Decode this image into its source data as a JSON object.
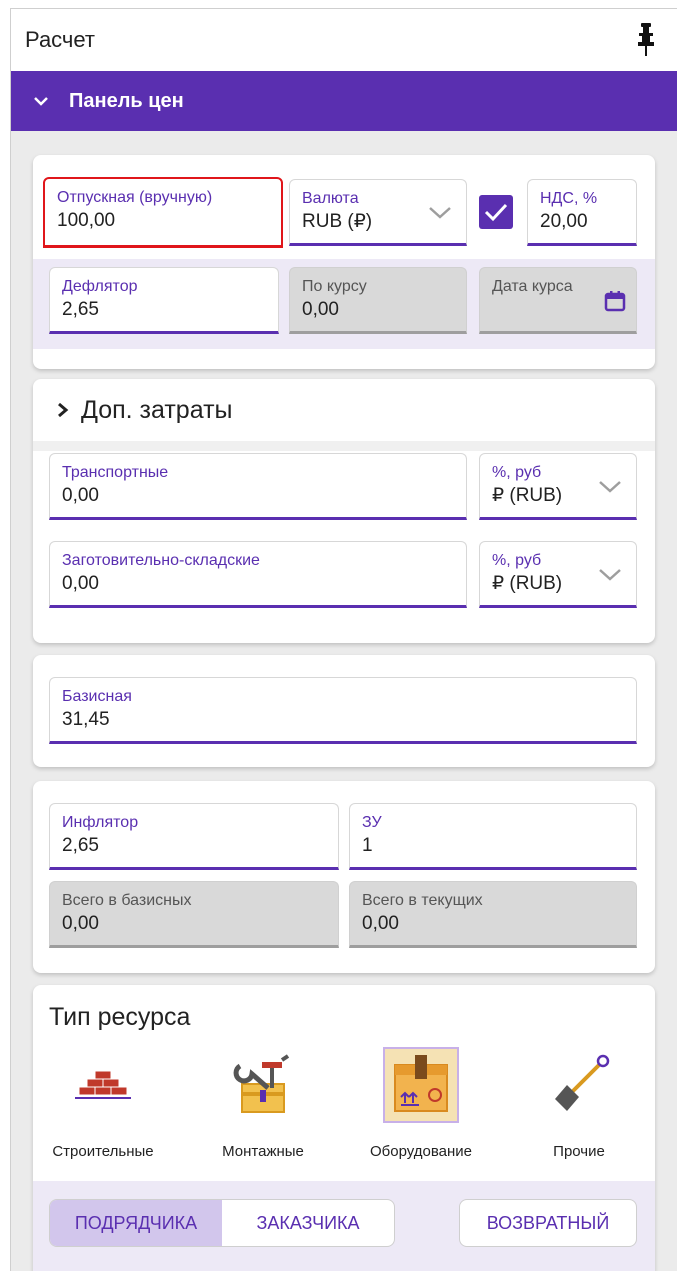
{
  "window": {
    "title": "Расчет",
    "pin_icon": "pin-icon"
  },
  "panel": {
    "title": "Панель цен",
    "chevron_icon": "chevron-down-icon"
  },
  "prices": {
    "release": {
      "label": "Отпускная (вручную)",
      "value": "100,00"
    },
    "currency": {
      "label": "Валюта",
      "value": "RUB (₽)"
    },
    "vat_checkbox": {
      "checked": true
    },
    "vat": {
      "label": "НДС, %",
      "value": "20,00"
    },
    "deflator": {
      "label": "Дефлятор",
      "value": "2,65"
    },
    "by_rate": {
      "label": "По курсу",
      "value": "0,00"
    },
    "rate_date": {
      "label": "Дата курса",
      "value": "",
      "icon": "calendar-icon"
    }
  },
  "extra_costs": {
    "title": "Доп. затраты",
    "transport": {
      "label": "Транспортные",
      "value": "0,00",
      "unit_label": "%, руб",
      "unit_value": "₽ (RUB)"
    },
    "warehouse": {
      "label": "Заготовительно-складские",
      "value": "0,00",
      "unit_label": "%, руб",
      "unit_value": "₽ (RUB)"
    }
  },
  "base": {
    "label": "Базисная",
    "value": "31,45"
  },
  "totals": {
    "inflator": {
      "label": "Инфлятор",
      "value": "2,65"
    },
    "zu": {
      "label": "ЗУ",
      "value": "1"
    },
    "total_base": {
      "label": "Всего в базисных",
      "value": "0,00"
    },
    "total_current": {
      "label": "Всего в текущих",
      "value": "0,00"
    }
  },
  "resource_type": {
    "title": "Тип ресурса",
    "items": [
      {
        "label": "Строительные",
        "icon": "bricks-icon",
        "selected": false
      },
      {
        "label": "Монтажные",
        "icon": "toolbox-icon",
        "selected": false
      },
      {
        "label": "Оборудование",
        "icon": "box-icon",
        "selected": true
      },
      {
        "label": "Прочие",
        "icon": "shovel-icon",
        "selected": false
      }
    ]
  },
  "actions": {
    "contractor": "ПОДРЯДЧИКА",
    "customer": "ЗАКАЗЧИКА",
    "returnable": "ВОЗВРАТНЫЙ",
    "active": "contractor"
  },
  "colors": {
    "accent": "#5a2fb0",
    "highlight": "#e0161b",
    "lavender": "#ede9f6"
  }
}
